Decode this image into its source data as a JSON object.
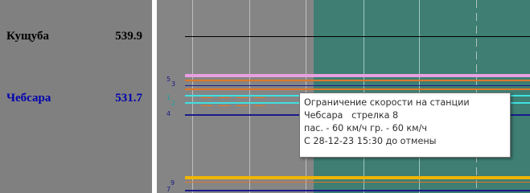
{
  "stations": [
    {
      "name": "Кущуба",
      "km": "539.9",
      "color": "#000000"
    },
    {
      "name": "Чебсара",
      "km": "531.7",
      "color": "#0000b0"
    }
  ],
  "tracks": {
    "label_5": "5",
    "label_3": "3",
    "label_1": "1",
    "label_2": "2",
    "label_4": "4",
    "label_9": "9",
    "label_7": "7"
  },
  "tooltip": {
    "line1": "Ограничение скорости на станции",
    "line2": "Чебсара   стрелка 8",
    "line3": "пас. - 60 км/ч гр. - 60 км/ч",
    "line4": "С 28-12-23 15:30 до отмены"
  },
  "colors": {
    "panel": "#808080",
    "chart_gray": "#858585",
    "teal_zone": "#3e7e73",
    "track_pink": "#e8a0e0",
    "track_orange": "#e07828",
    "track_navy": "#1a1a8a",
    "track_cyan": "#40e0e0",
    "track_yellow": "#f0b400"
  }
}
